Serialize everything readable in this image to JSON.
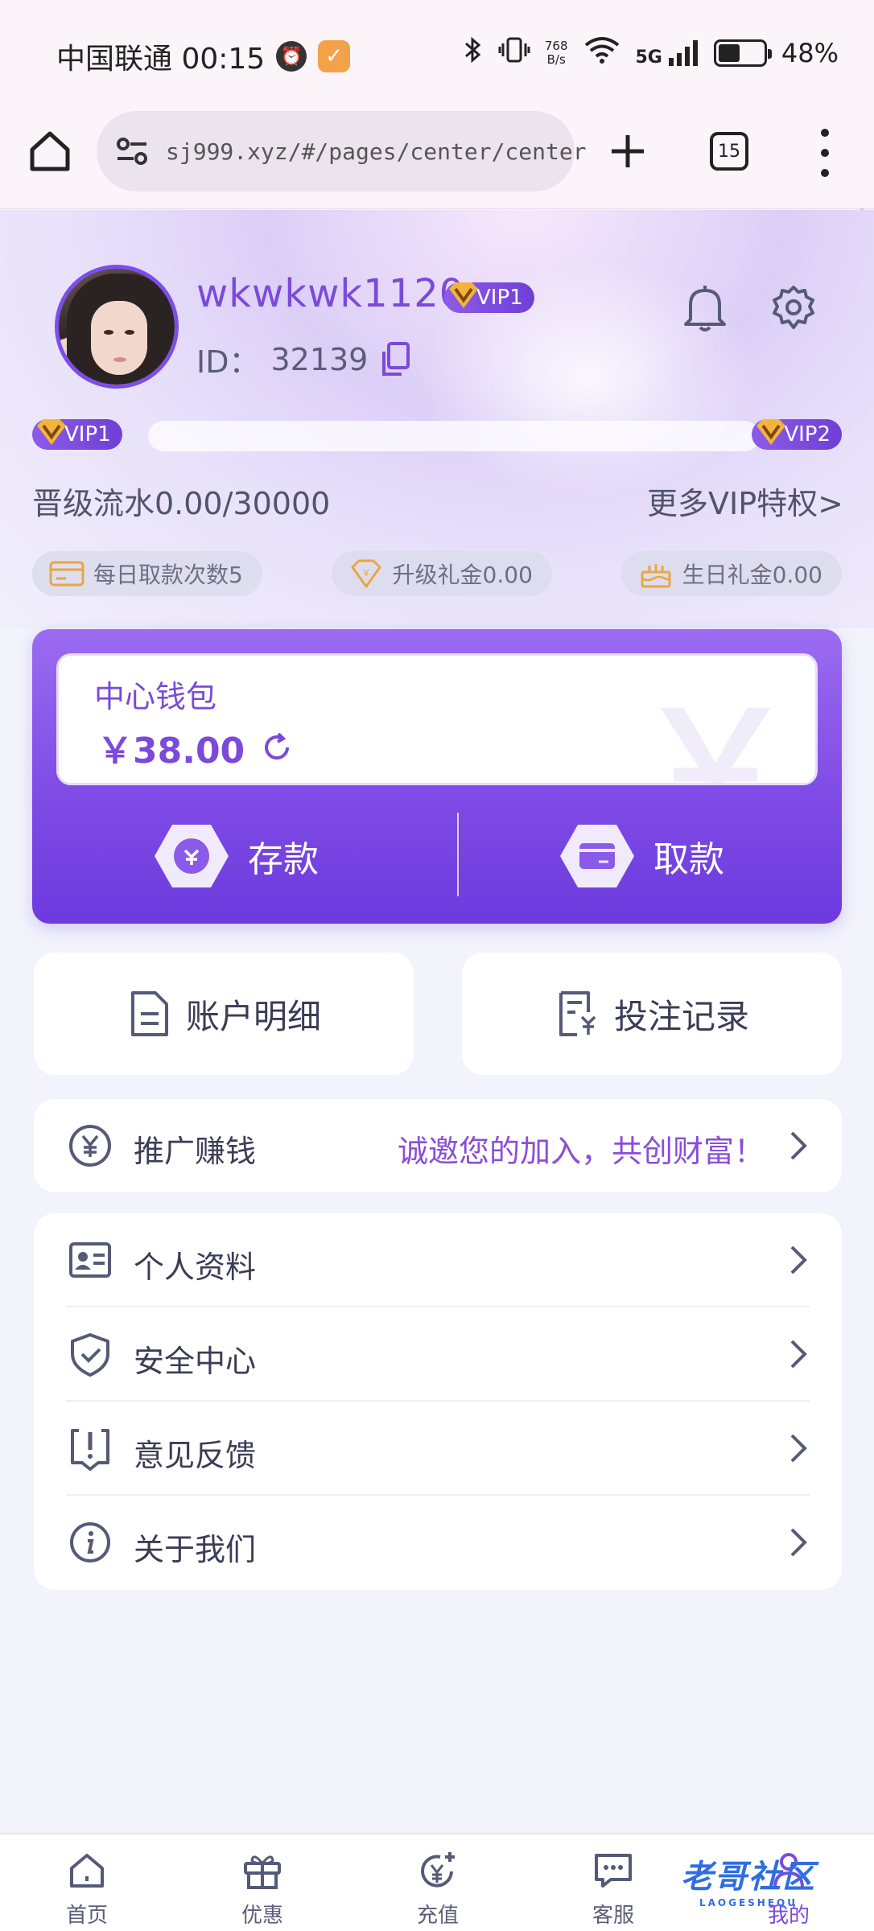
{
  "status_bar": {
    "carrier_time": "中国联通 00:15",
    "speed_top": "768",
    "speed_bottom": "B/s",
    "network": "5G",
    "battery": "48%",
    "battery_level": 0.48
  },
  "browser": {
    "url": "sj999.xyz/#/pages/center/center",
    "tab_count": "15"
  },
  "profile": {
    "username": "wkwkwk1120",
    "vip_level": "VIP1",
    "id_label": "ID：",
    "id_value": "32139"
  },
  "vip_progress": {
    "current_level": "VIP1",
    "next_level": "VIP2",
    "progress": 0.0,
    "upgrade_text": "晋级流水0.00/30000",
    "more_link": "更多VIP特权>"
  },
  "perks": [
    {
      "icon": "card-icon",
      "label": "每日取款次数5"
    },
    {
      "icon": "gift-diamond-icon",
      "label": "升级礼金0.00"
    },
    {
      "icon": "birthday-cake-icon",
      "label": "生日礼金0.00"
    }
  ],
  "wallet": {
    "title": "中心钱包",
    "amount": "￥38.00",
    "deposit_label": "存款",
    "withdraw_label": "取款",
    "watermark": "￥"
  },
  "records": {
    "account_detail": "账户明细",
    "bet_record": "投注记录"
  },
  "promo": {
    "label": "推广赚钱",
    "slogan": "诚邀您的加入，共创财富！"
  },
  "menu": [
    {
      "icon": "profile-card-icon",
      "label": "个人资料"
    },
    {
      "icon": "shield-icon",
      "label": "安全中心"
    },
    {
      "icon": "feedback-icon",
      "label": "意见反馈"
    },
    {
      "icon": "info-icon",
      "label": "关于我们"
    }
  ],
  "bottom_nav": [
    {
      "icon": "home-icon",
      "label": "首页"
    },
    {
      "icon": "gift-icon",
      "label": "优惠"
    },
    {
      "icon": "recharge-icon",
      "label": "充值"
    },
    {
      "icon": "chat-icon",
      "label": "客服"
    },
    {
      "icon": "user-icon",
      "label": "我的"
    }
  ],
  "watermark": {
    "text": "老哥社区",
    "subtext": "LAOGESHEQU"
  },
  "colors": {
    "accent": "#7b4ad9",
    "wallet_gradient_top": "#9b6cf1",
    "wallet_gradient_bottom": "#6d3ade",
    "page_bg": "#f2f3fb"
  }
}
